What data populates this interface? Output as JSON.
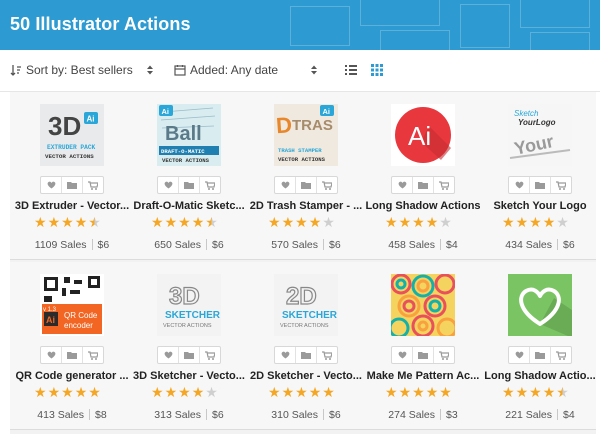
{
  "header": {
    "title": "50 Illustrator Actions"
  },
  "toolbar": {
    "sort_label": "Sort by: Best sellers",
    "added_label": "Added: Any date"
  },
  "colors": {
    "header_bg": "#2d9bd1",
    "star_on": "#f5a623",
    "star_off": "#cfcfcf",
    "view_active": "#2d9bd1"
  },
  "rows": [
    {
      "items": [
        {
          "name": "3D Extruder - Vector...",
          "rating": 4.5,
          "sales": "1109 Sales",
          "price": "$6",
          "thumb": "3d-extruder"
        },
        {
          "name": "Draft-O-Matic Sketc...",
          "rating": 4.5,
          "sales": "650 Sales",
          "price": "$6",
          "thumb": "draft-o-matic"
        },
        {
          "name": "2D Trash Stamper - ...",
          "rating": 4,
          "sales": "570 Sales",
          "price": "$6",
          "thumb": "trash-stamper"
        },
        {
          "name": "Long Shadow Actions",
          "rating": 4,
          "sales": "458 Sales",
          "price": "$4",
          "thumb": "ai-long-shadow"
        },
        {
          "name": "Sketch Your Logo",
          "rating": 4,
          "sales": "434 Sales",
          "price": "$6",
          "thumb": "sketch-your-logo"
        }
      ]
    },
    {
      "items": [
        {
          "name": "QR Code generator ...",
          "rating": 5,
          "sales": "413 Sales",
          "price": "$8",
          "thumb": "qr-code"
        },
        {
          "name": "3D Sketcher - Vecto...",
          "rating": 4,
          "sales": "313 Sales",
          "price": "$6",
          "thumb": "3d-sketcher"
        },
        {
          "name": "2D Sketcher - Vecto...",
          "rating": 5,
          "sales": "310 Sales",
          "price": "$6",
          "thumb": "2d-sketcher"
        },
        {
          "name": "Make Me Pattern Ac...",
          "rating": 5,
          "sales": "274 Sales",
          "price": "$3",
          "thumb": "pattern"
        },
        {
          "name": "Long Shadow Actio...",
          "rating": 4.5,
          "sales": "221 Sales",
          "price": "$4",
          "thumb": "heart-long-shadow"
        }
      ]
    }
  ]
}
